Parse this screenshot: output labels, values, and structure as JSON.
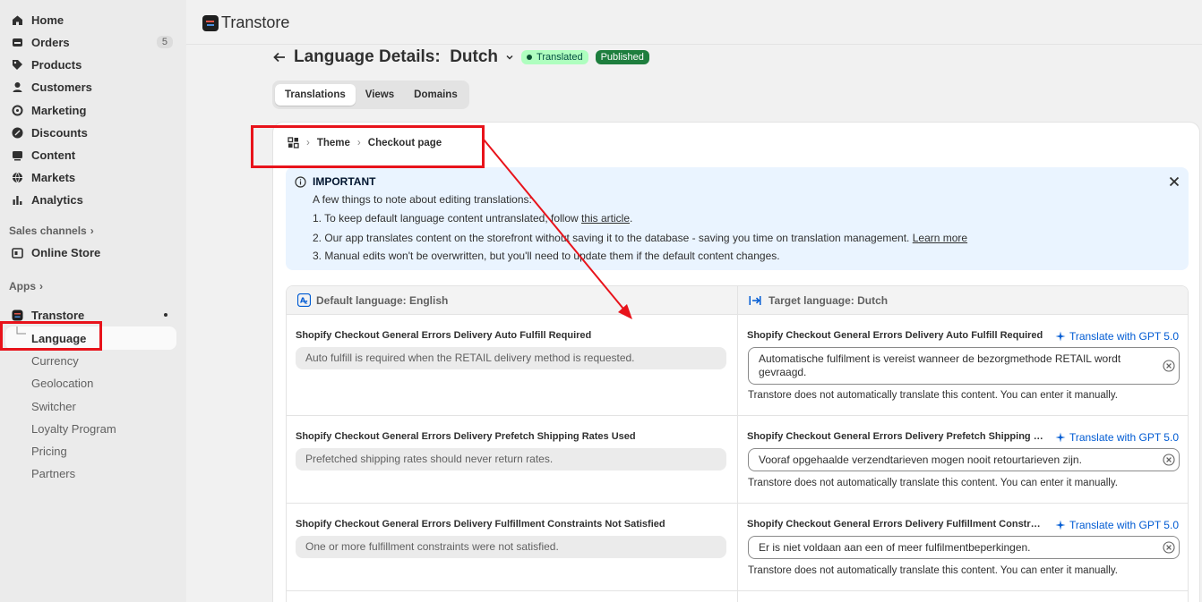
{
  "sidebar": {
    "items": [
      {
        "label": "Home",
        "icon": "home-icon"
      },
      {
        "label": "Orders",
        "icon": "orders-icon",
        "badge": "5"
      },
      {
        "label": "Products",
        "icon": "tag-icon"
      },
      {
        "label": "Customers",
        "icon": "person-icon"
      },
      {
        "label": "Marketing",
        "icon": "target-icon"
      },
      {
        "label": "Discounts",
        "icon": "discount-icon"
      },
      {
        "label": "Content",
        "icon": "content-icon"
      },
      {
        "label": "Markets",
        "icon": "globe-icon"
      },
      {
        "label": "Analytics",
        "icon": "bar-chart-icon"
      }
    ],
    "sales_channels_label": "Sales channels",
    "online_store": "Online Store",
    "apps_label": "Apps",
    "app_name": "Transtore",
    "app_subitems": [
      "Language",
      "Currency",
      "Geolocation",
      "Switcher",
      "Loyalty Program",
      "Pricing",
      "Partners"
    ]
  },
  "topbar": {
    "brand": "Transtore"
  },
  "page": {
    "title": "Language Details:  Dutch",
    "status_translated": "Translated",
    "status_published": "Published",
    "tabs": [
      "Translations",
      "Views",
      "Domains"
    ]
  },
  "breadcrumb": {
    "theme": "Theme",
    "current": "Checkout page"
  },
  "banner": {
    "heading": "IMPORTANT",
    "intro": "A few things to note about editing translations:",
    "line1_prefix": "1. To keep default language content untranslated, follow ",
    "line1_link": "this article",
    "line1_suffix": ".",
    "line2_prefix": "2. Our app translates content on the storefront without saving it to the database - saving you time on translation management. ",
    "line2_link": "Learn more",
    "line3": "3. Manual edits won't be overwritten, but you'll need to update them if the default content changes."
  },
  "table": {
    "default_header": "Default language: English",
    "target_header": "Target language: Dutch",
    "gpt_label": "Translate with GPT 5.0",
    "manual_note": "Transtore does not automatically translate this content. You can enter it manually.",
    "rows": [
      {
        "key": "Shopify Checkout General Errors Delivery Auto Fulfill Required",
        "target_key": "Shopify Checkout General Errors Delivery Auto Fulfill Required",
        "source": "Auto fulfill is required when the RETAIL delivery method is requested.",
        "target": "Automatische fulfilment is vereist wanneer de bezorgmethode RETAIL wordt gevraagd."
      },
      {
        "key": "Shopify Checkout General Errors Delivery Prefetch Shipping Rates Used",
        "target_key": "Shopify Checkout General Errors Delivery Prefetch Shipping R...",
        "source": "Prefetched shipping rates should never return rates.",
        "target": "Vooraf opgehaalde verzendtarieven mogen nooit retourtarieven zijn."
      },
      {
        "key": "Shopify Checkout General Errors Delivery Fulfillment Constraints Not Satisfied",
        "target_key": "Shopify Checkout General Errors Delivery Fulfillment Constrai...",
        "source": "One or more fulfillment constraints were not satisfied.",
        "target": "Er is niet voldaan aan een of meer fulfilmentbeperkingen."
      }
    ]
  },
  "colors": {
    "annotation": "#e8131b",
    "link": "#005bd3",
    "translated_bg": "#affebf",
    "published_bg": "#1e7e3e",
    "banner_bg": "#eaf4ff"
  }
}
